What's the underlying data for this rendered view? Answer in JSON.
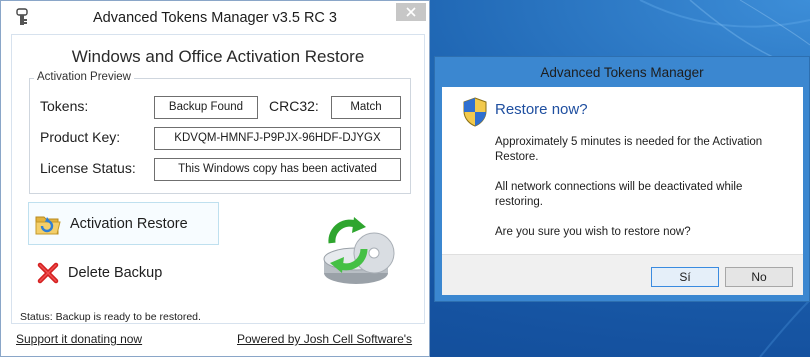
{
  "main_window": {
    "title": "Advanced Tokens Manager v3.5 RC 3",
    "heading": "Windows and Office Activation Restore",
    "group_legend": "Activation Preview",
    "fields": {
      "tokens_label": "Tokens:",
      "tokens_value": "Backup Found",
      "crc32_label": "CRC32:",
      "crc32_value": "Match",
      "product_key_label": "Product Key:",
      "product_key_value": "KDVQM-HMNFJ-P9PJX-96HDF-DJYGX",
      "license_status_label": "License Status:",
      "license_status_value": "This Windows copy has been activated"
    },
    "actions": {
      "restore_label": "Activation Restore",
      "delete_label": "Delete Backup"
    },
    "status_text": "Status:  Backup is ready to be restored.",
    "footer": {
      "support_link": "Support it donating now",
      "powered_link": "Powered by Josh Cell Software's"
    }
  },
  "dialog": {
    "title": "Advanced Tokens Manager",
    "heading": "Restore now?",
    "message_1": "Approximately 5 minutes is needed for the Activation Restore.",
    "message_2": "All network connections will be deactivated while restoring.",
    "message_3": "Are you sure you wish to restore now?",
    "yes_label": "Sí",
    "no_label": "No"
  },
  "colors": {
    "desktop": "#1f66b3",
    "dialog_frame": "#3b87d0",
    "dialog_heading": "#1f4fa0",
    "close_button": "#c7c7c7"
  },
  "icons": {
    "app": "tokens-app-icon",
    "close": "close-icon",
    "restore": "folder-restore-icon",
    "delete": "red-x-icon",
    "hero": "disc-refresh-icon",
    "shield": "uac-shield-icon"
  }
}
